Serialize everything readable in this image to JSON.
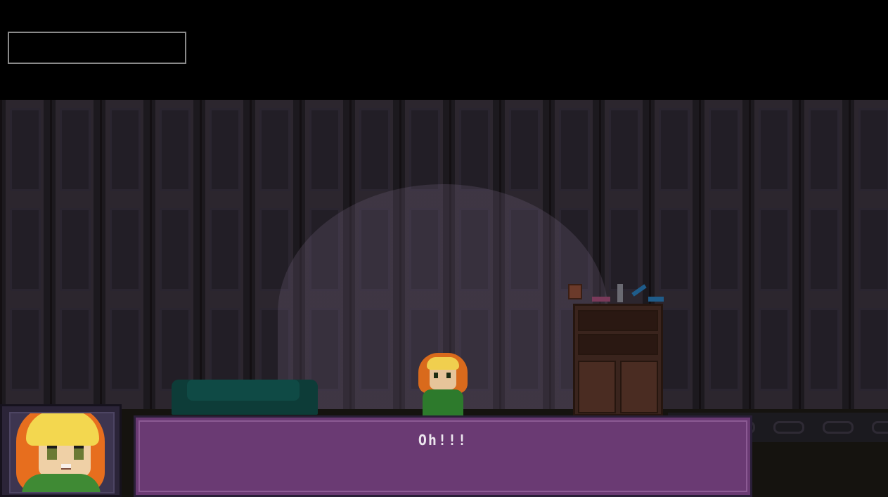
{
  "hud": {
    "name_box": ""
  },
  "scene": {
    "location": "room"
  },
  "dialog": {
    "text": "Oh!!!"
  },
  "colors": {
    "dialog_bg": "#6a3a73",
    "dialog_border": "#2a1f38",
    "name_box_border": "#8a8a8a",
    "sofa": "#0d3c38",
    "character_hair": "#d96a1c",
    "character_shirt": "#2d7a2c"
  }
}
